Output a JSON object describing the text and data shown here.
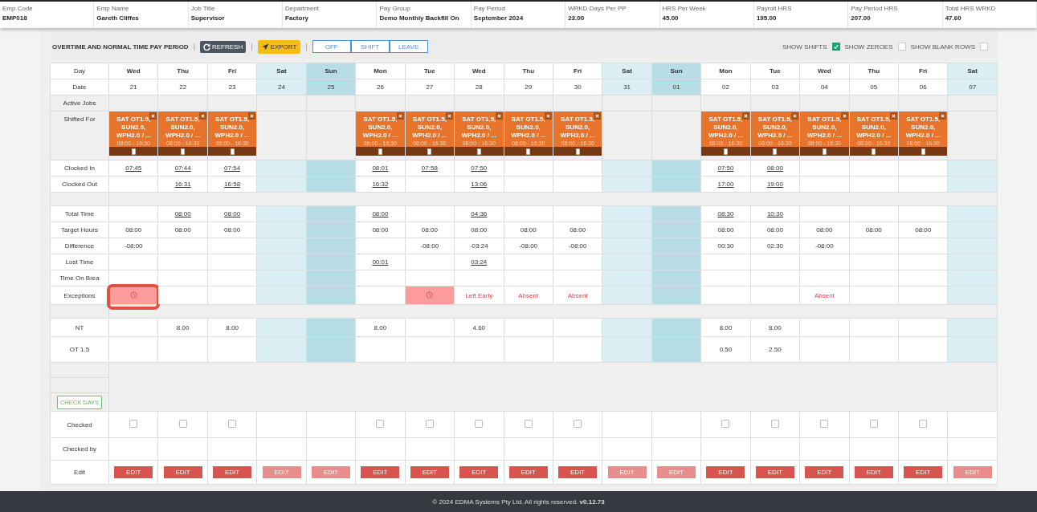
{
  "header": [
    {
      "label": "Emp Code",
      "value": "EMP018"
    },
    {
      "label": "Emp Name",
      "value": "Gareth Cliffes"
    },
    {
      "label": "Job Title",
      "value": "Supervisor"
    },
    {
      "label": "Department",
      "value": "Factory"
    },
    {
      "label": "Pay Group",
      "value": "Demo Monthly Backfill On"
    },
    {
      "label": "Pay Period",
      "value": "September 2024"
    },
    {
      "label": "WRKD Days Per PP",
      "value": "23.00"
    },
    {
      "label": "HRS Per Week",
      "value": "45.00"
    },
    {
      "label": "Payroll HRS",
      "value": "195.00"
    },
    {
      "label": "Pay Period HRS",
      "value": "207.00"
    },
    {
      "label": "Total HRS WRKD",
      "value": "47.60"
    }
  ],
  "toolbar": {
    "title": "OVERTIME AND NORMAL TIME PAY PERIOD",
    "separators": [
      "|",
      "|",
      "|"
    ],
    "refresh": "REFRESH",
    "export": "EXPORT",
    "modes": [
      {
        "label": "OFF",
        "selected": false
      },
      {
        "label": "SHIFT",
        "selected": false
      },
      {
        "label": "LEAVE",
        "selected": false
      }
    ],
    "toggles": [
      {
        "label": "SHOW SHIFTS",
        "checked": true
      },
      {
        "label": "SHOW ZEROES",
        "checked": false
      },
      {
        "label": "SHOW BLANK ROWS",
        "checked": false
      }
    ]
  },
  "labels": {
    "day": "Day",
    "date": "Date",
    "active_jobs": "Active Jobs",
    "shifted_for": "Shifted For",
    "clocked_in": "Clocked In",
    "clocked_out": "Clocked Out",
    "total_time": "Total Time",
    "target": "Target Hours",
    "difference": "Difference",
    "lost_time": "Lost Time",
    "break": "Time On Brea",
    "exceptions": "Exceptions",
    "nt": "NT",
    "ot15": "OT 1.5",
    "check_days": "CHECK DAYS",
    "checked": "Checked",
    "checked_by": "Checked by",
    "edit": "Edit"
  },
  "days": [
    {
      "day": "Wed",
      "date": "21",
      "kind": "weekday",
      "shift": {
        "name": "SAT OT1.5, SUN2.0, WPH2.0 / ...",
        "time": "08:00 - 16:30"
      },
      "clocked_in": "07:45",
      "target": "08:00",
      "difference": "-08:00",
      "exception": {
        "kind": "clock",
        "highlighted": true
      },
      "checked": false,
      "edit": {
        "label": "EDIT",
        "disabled": false
      }
    },
    {
      "day": "Thu",
      "date": "22",
      "kind": "weekday",
      "shift": {
        "name": "SAT OT1.5, SUN2.0, WPH2.0 / ...",
        "time": "08:00 - 16:30"
      },
      "clocked_in": "07:44",
      "clocked_out": "16:31",
      "total_time": "08:00",
      "target": "08:00",
      "nt": "8.00",
      "checked": false,
      "edit": {
        "label": "EDIT",
        "disabled": false
      }
    },
    {
      "day": "Fri",
      "date": "23",
      "kind": "weekday",
      "shift": {
        "name": "SAT OT1.5, SUN2.0, WPH2.0 / ...",
        "time": "08:00 - 16:30"
      },
      "clocked_in": "07:54",
      "clocked_out": "16:58",
      "total_time": "08:00",
      "target": "08:00",
      "nt": "8.00",
      "checked": false,
      "edit": {
        "label": "EDIT",
        "disabled": false
      }
    },
    {
      "day": "Sat",
      "date": "24",
      "kind": "sat",
      "edit": {
        "label": "EDIT",
        "disabled": true
      }
    },
    {
      "day": "Sun",
      "date": "25",
      "kind": "sun",
      "edit": {
        "label": "EDIT",
        "disabled": true
      }
    },
    {
      "day": "Mon",
      "date": "26",
      "kind": "weekday",
      "shift": {
        "name": "SAT OT1.5, SUN2.0, WPH2.0 / ...",
        "time": "08:00 - 16:30"
      },
      "clocked_in": "08:01",
      "clocked_out": "16:32",
      "total_time": "08:00",
      "target": "08:00",
      "lost_time": "00:01",
      "nt": "8.00",
      "checked": false,
      "edit": {
        "label": "EDIT",
        "disabled": false
      }
    },
    {
      "day": "Tue",
      "date": "27",
      "kind": "weekday",
      "shift": {
        "name": "SAT OT1.5, SUN2.0, WPH2.0 / ...",
        "time": "08:00 - 16:30"
      },
      "clocked_in": "07:58",
      "target": "08:00",
      "difference": "-08:00",
      "exception": {
        "kind": "clock",
        "highlighted": false
      },
      "checked": false,
      "edit": {
        "label": "EDIT",
        "disabled": false
      }
    },
    {
      "day": "Wed",
      "date": "28",
      "kind": "weekday",
      "shift": {
        "name": "SAT OT1.5, SUN2.0, WPH2.0 / ...",
        "time": "08:00 - 16:30"
      },
      "clocked_in": "07:50",
      "clocked_out": "13:06",
      "total_time": "04:36",
      "target": "08:00",
      "difference": "-03:24",
      "lost_time": "03:24",
      "exception": {
        "kind": "text",
        "text": "Left Early",
        "highlighted": false
      },
      "nt": "4.60",
      "checked": false,
      "edit": {
        "label": "EDIT",
        "disabled": false
      }
    },
    {
      "day": "Thu",
      "date": "29",
      "kind": "weekday",
      "shift": {
        "name": "SAT OT1.5, SUN2.0, WPH2.0 / ...",
        "time": "08:00 - 16:30"
      },
      "target": "08:00",
      "difference": "-08:00",
      "exception": {
        "kind": "text",
        "text": "Absent",
        "highlighted": false
      },
      "checked": false,
      "edit": {
        "label": "EDIT",
        "disabled": false
      }
    },
    {
      "day": "Fri",
      "date": "30",
      "kind": "weekday",
      "shift": {
        "name": "SAT OT1.5, SUN2.0, WPH2.0 / ...",
        "time": "08:00 - 16:30"
      },
      "target": "08:00",
      "difference": "-08:00",
      "exception": {
        "kind": "text",
        "text": "Absent",
        "highlighted": false
      },
      "checked": false,
      "edit": {
        "label": "EDIT",
        "disabled": false
      }
    },
    {
      "day": "Sat",
      "date": "31",
      "kind": "sat",
      "edit": {
        "label": "EDIT",
        "disabled": true
      }
    },
    {
      "day": "Sun",
      "date": "01",
      "kind": "sun",
      "edit": {
        "label": "EDIT",
        "disabled": true
      }
    },
    {
      "day": "Mon",
      "date": "02",
      "kind": "weekday",
      "shift": {
        "name": "SAT OT1.5, SUN2.0, WPH2.0 / ...",
        "time": "08:00 - 16:30"
      },
      "clocked_in": "07:50",
      "clocked_out": "17:00",
      "total_time": "08:30",
      "target": "08:00",
      "difference": "00:30",
      "nt": "8.00",
      "ot15": "0.50",
      "checked": false,
      "edit": {
        "label": "EDIT",
        "disabled": false
      }
    },
    {
      "day": "Tue",
      "date": "03",
      "kind": "weekday",
      "shift": {
        "name": "SAT OT1.5, SUN2.0, WPH2.0 / ...",
        "time": "08:00 - 16:30"
      },
      "clocked_in": "08:00",
      "clocked_out": "19:00",
      "total_time": "10:30",
      "target": "08:00",
      "difference": "02:30",
      "nt": "8.00",
      "ot15": "2.50",
      "checked": false,
      "edit": {
        "label": "EDIT",
        "disabled": false
      }
    },
    {
      "day": "Wed",
      "date": "04",
      "kind": "weekday",
      "shift": {
        "name": "SAT OT1.5, SUN2.0, WPH2.0 / ...",
        "time": "08:00 - 16:30"
      },
      "target": "08:00",
      "difference": "-08:00",
      "exception": {
        "kind": "text",
        "text": "Absent",
        "highlighted": false
      },
      "checked": false,
      "edit": {
        "label": "EDIT",
        "disabled": false
      }
    },
    {
      "day": "Thu",
      "date": "05",
      "kind": "weekday",
      "shift": {
        "name": "SAT OT1.5, SUN2.0, WPH2.0 / ...",
        "time": "08:00 - 16:30"
      },
      "target": "08:00",
      "checked": false,
      "edit": {
        "label": "EDIT",
        "disabled": false
      }
    },
    {
      "day": "Fri",
      "date": "06",
      "kind": "weekday",
      "shift": {
        "name": "SAT OT1.5, SUN2.0, WPH2.0 / ...",
        "time": "08:00 - 16:30"
      },
      "target": "08:00",
      "checked": false,
      "edit": {
        "label": "EDIT",
        "disabled": false
      }
    },
    {
      "day": "Sat",
      "date": "07",
      "kind": "sat",
      "edit": {
        "label": "EDIT",
        "disabled": true
      }
    }
  ],
  "footer": "© 2024 EDMA Systems Pty Ltd. All rights reserved. **v0.12.73**"
}
